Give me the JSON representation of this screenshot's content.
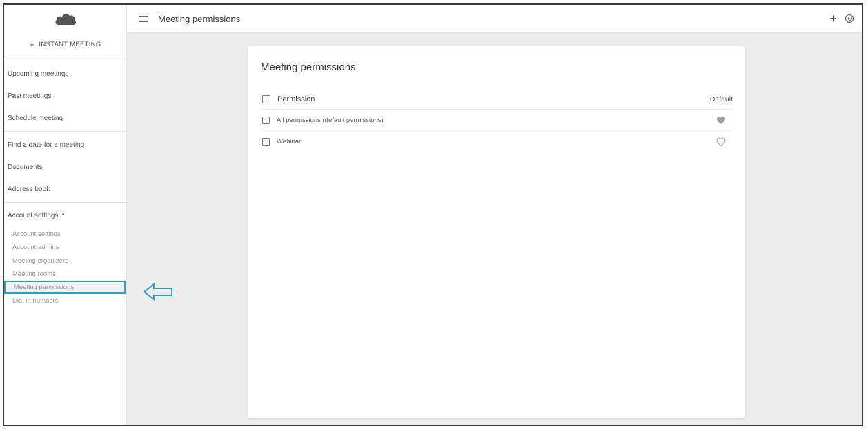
{
  "sidebar": {
    "instant_meeting_label": "INSTANT MEETING",
    "nav_group_1": [
      "Upcoming meetings",
      "Past meetings",
      "Schedule meeting"
    ],
    "nav_group_2": [
      "Find a date for a meeting",
      "Documents",
      "Address book"
    ],
    "account_settings_header": "Account settings",
    "account_sub_items": [
      "Account settings",
      "Account admins",
      "Meeting organizers",
      "Meeting rooms",
      "Meeting permissions",
      "Dial-in numbers"
    ],
    "active_sub_item": "Meeting permissions"
  },
  "topbar": {
    "title": "Meeting permissions"
  },
  "card": {
    "title": "Meeting permissions",
    "columns": {
      "permission": "Permission",
      "default": "Default"
    },
    "rows": [
      {
        "label": "All permissions (default permissions)",
        "is_default": true
      },
      {
        "label": "Webinar",
        "is_default": false
      }
    ]
  },
  "colors": {
    "highlight": "#2c9ec9",
    "background": "#ececec",
    "heart_filled": "#9e9e9e"
  },
  "icons": [
    "cloud-logo-icon",
    "plus-icon",
    "hamburger-menu-icon",
    "add-icon",
    "user-account-icon",
    "chevron-up-icon",
    "heart-filled-icon",
    "heart-outline-icon",
    "left-arrow-annotation-icon"
  ]
}
